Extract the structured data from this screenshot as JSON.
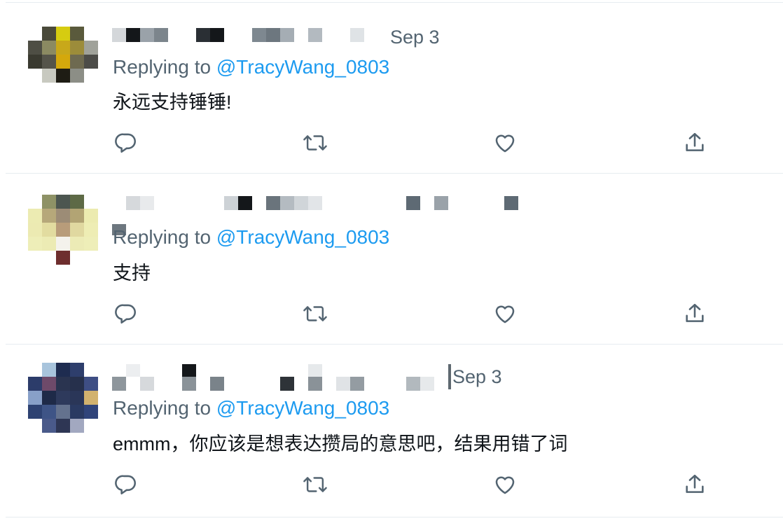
{
  "timeline": {
    "tweets": [
      {
        "date": "Sep 3",
        "replying_prefix": "Replying to ",
        "handle": "@TracyWang_0803",
        "text": "永远支持锤锤!"
      },
      {
        "date": "",
        "replying_prefix": "Replying to ",
        "handle": "@TracyWang_0803",
        "text": "支持"
      },
      {
        "date": "Sep 3",
        "replying_prefix": "Replying to ",
        "handle": "@TracyWang_0803",
        "text": "emmm，你应该是想表达攒局的意思吧，结果用错了词"
      }
    ]
  },
  "icons": {
    "reply": "speech-bubble-icon",
    "retweet": "retweet-arrows-icon",
    "like": "heart-icon",
    "share": "share-upload-icon"
  },
  "colors": {
    "handle": "#1d9bf0",
    "secondary_text": "#536471",
    "icon": "#536471",
    "border": "#e6ecf0"
  }
}
